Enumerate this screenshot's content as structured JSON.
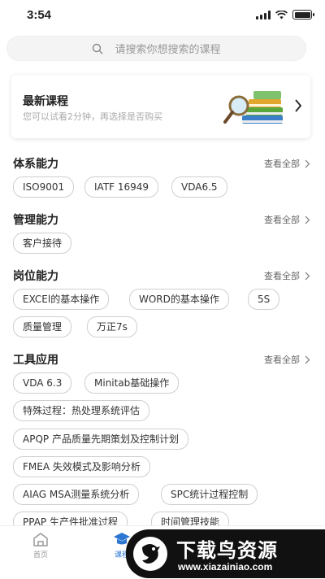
{
  "status_bar": {
    "time": "3:54"
  },
  "search": {
    "placeholder": "请搜索你想搜索的课程"
  },
  "banner": {
    "title": "最新课程",
    "subtitle": "您可以试看2分钟，再选择是否购买"
  },
  "sections": [
    {
      "title": "体系能力",
      "view_all": "查看全部",
      "tags": [
        "ISO9001",
        "IATF 16949",
        "VDA6.5"
      ]
    },
    {
      "title": "管理能力",
      "view_all": "查看全部",
      "tags": [
        "客户接待"
      ]
    },
    {
      "title": "岗位能力",
      "view_all": "查看全部",
      "tags": [
        "EXCEl的基本操作",
        "WORD的基本操作",
        "5S",
        "质量管理",
        "万正7s"
      ]
    },
    {
      "title": "工具应用",
      "view_all": "查看全部",
      "tags": [
        "VDA 6.3",
        "Minitab基础操作",
        "特殊过程：热处理系统评估",
        "APQP 产品质量先期策划及控制计划",
        "FMEA 失效模式及影响分析",
        "AIAG MSA测量系统分析",
        "SPC统计过程控制",
        "PPAP 生产件批准过程",
        "时间管理技能"
      ]
    }
  ],
  "tabbar": {
    "tabs": [
      {
        "label": "首页",
        "icon": "home-icon"
      },
      {
        "label": "课程",
        "icon": "graduation-cap-icon",
        "active": true
      }
    ]
  },
  "watermark": {
    "title": "下载鸟资源",
    "url": "www.xiazainiao.com"
  },
  "colors": {
    "accent": "#2b76d0",
    "tag_border": "#cfcfcf"
  }
}
